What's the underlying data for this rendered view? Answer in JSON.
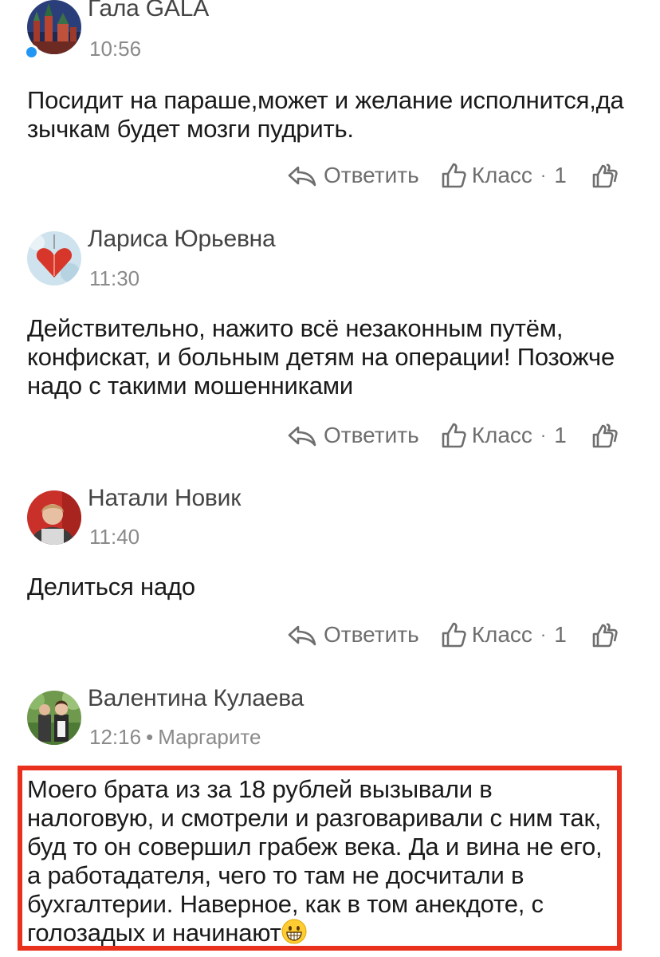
{
  "comments": [
    {
      "author": "Гала GALA",
      "time": "10:56",
      "text": "Посидит на параше,может и желание исполнится,да зычкам будет мозги пудрить.",
      "reply_label": "Ответить",
      "like_label": "Класс",
      "like_separator": "·",
      "like_count": "1"
    },
    {
      "author": "Лариса Юрьевна",
      "time": "11:30",
      "text": "Действительно, нажито всё незаконным путём, конфискат, и больным детям на операции! Позожче надо с такими мошенниками",
      "reply_label": "Ответить",
      "like_label": "Класс",
      "like_separator": "·",
      "like_count": "1"
    },
    {
      "author": "Натали Новик",
      "time": "11:40",
      "text": "Делиться надо",
      "reply_label": "Ответить",
      "like_label": "Класс",
      "like_separator": "·",
      "like_count": "1"
    },
    {
      "author": "Валентина Кулаева",
      "time": "12:16",
      "meta_separator": "•",
      "reply_to": "Маргарите",
      "text": "Моего брата из за 18 рублей вызывали в налоговую, и смотрели и разговаривали с ним так, буд то он совершил грабеж века. Да и вина не его, а работадателя, чего то там не досчитали в бухгалтерии. Наверное, как в том анекдоте, с голозадых и начинают"
    }
  ],
  "colors": {
    "highlight_border": "#e8301c",
    "online_dot": "#2196f3",
    "action_text": "#6e6e6e",
    "meta_text": "#8a8a8a"
  },
  "icons": {
    "reply": "reply-arrow-icon",
    "like": "thumbs-up-icon",
    "reactions": "double-thumbs-up-icon",
    "emoji": "grinning-face-emoji"
  }
}
